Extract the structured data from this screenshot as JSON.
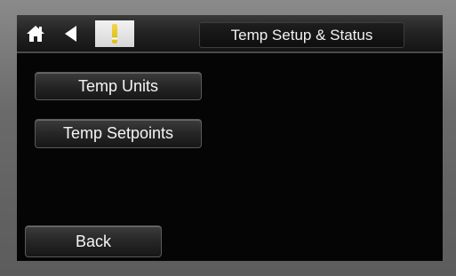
{
  "header": {
    "title": "Temp Setup & Status",
    "icons": [
      "home-icon",
      "back-arrow-icon",
      "alert-icon"
    ],
    "alert_symbol": "!"
  },
  "menu": {
    "buttons": [
      {
        "label": "Temp Units"
      },
      {
        "label": "Temp Setpoints"
      }
    ]
  },
  "footer": {
    "back_label": "Back"
  },
  "colors": {
    "screen_bg": "#050505",
    "bezel": "#6f6f6f",
    "text": "#f2f2f2",
    "alert_yellow": "#e0c020"
  }
}
